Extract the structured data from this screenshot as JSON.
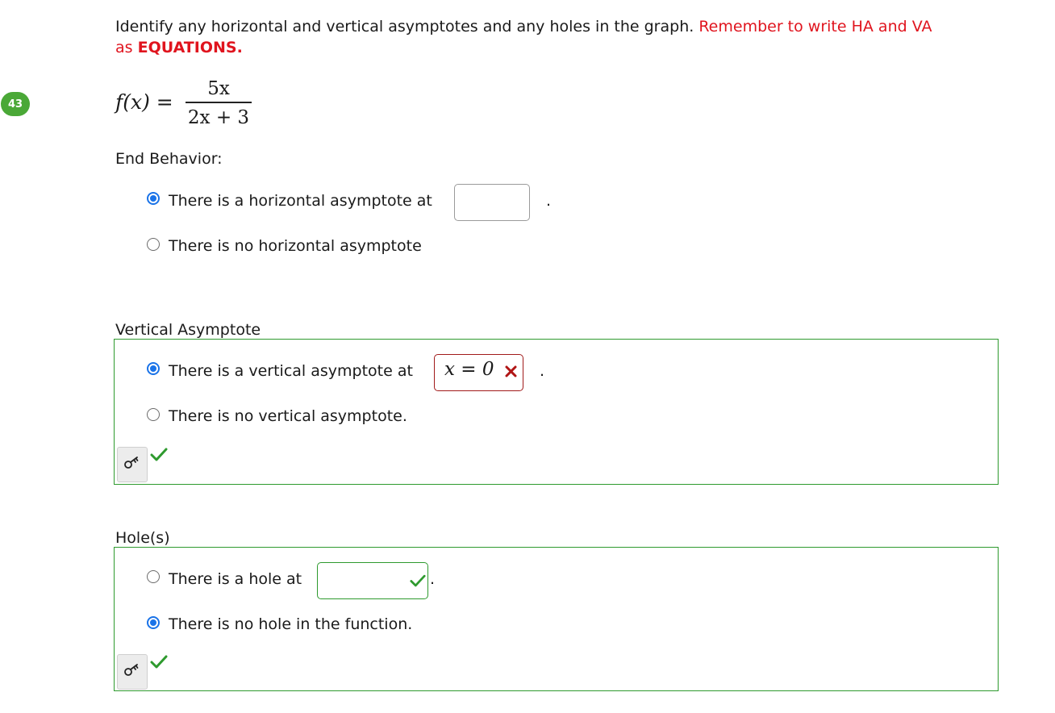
{
  "instructions": {
    "main": "Identify any horizontal and vertical asymptotes and any holes in the graph.",
    "remember": "Remember to write HA and VA",
    "as": "as",
    "equations": "EQUATIONS",
    "period": "."
  },
  "question_number": "43",
  "function": {
    "lhs": "f(x) =",
    "numerator": "5x",
    "denominator": "2x + 3"
  },
  "end_behavior": {
    "label": "End Behavior:",
    "options": [
      {
        "text": "There is a horizontal asymptote at",
        "checked": true,
        "input_value": "",
        "trailing": "."
      },
      {
        "text": "There is no horizontal asymptote",
        "checked": false
      }
    ]
  },
  "vertical_asymptote": {
    "label": "Vertical Asymptote",
    "options": [
      {
        "text": "There is a vertical asymptote at",
        "checked": true,
        "input_value": "x = 0",
        "status": "incorrect",
        "trailing": "."
      },
      {
        "text": "There is no vertical asymptote.",
        "checked": false
      }
    ],
    "status": "correct"
  },
  "holes": {
    "label": "Hole(s)",
    "options": [
      {
        "text": "There is a hole at",
        "checked": false,
        "input_value": "",
        "status": "correct",
        "trailing": "."
      },
      {
        "text": "There is no hole in the function.",
        "checked": true
      }
    ],
    "status": "correct"
  },
  "icons": {
    "key": "key-icon",
    "check": "check-icon",
    "cross": "cross-icon"
  },
  "colors": {
    "accent_blue": "#1a73e8",
    "correct_green": "#2e9a2e",
    "error_red": "#e0141e",
    "badge_green": "#4aa837",
    "wrong_input_border": "#a11a1a"
  }
}
